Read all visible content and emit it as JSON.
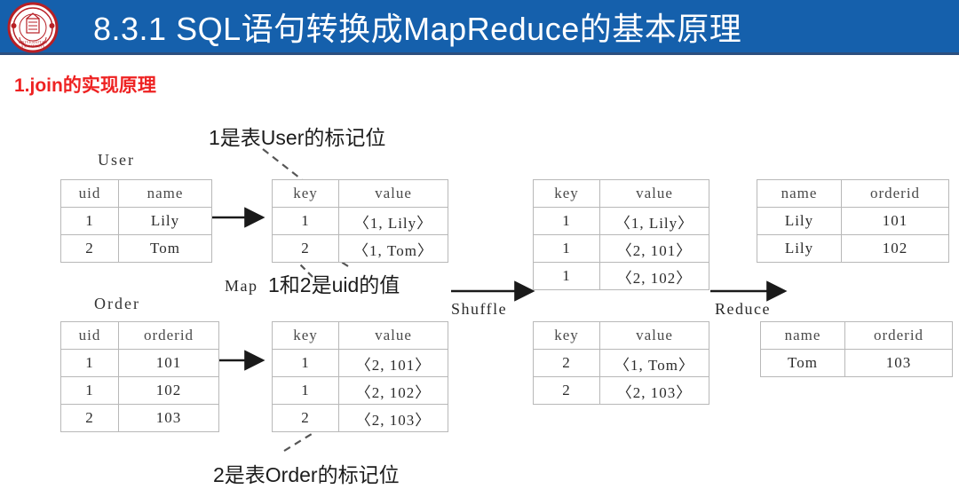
{
  "header": {
    "title": "8.3.1  SQL语句转换成MapReduce的基本原理",
    "logo_name": "university-seal-logo",
    "bar_color": "#1560ac",
    "title_color": "#ffffff"
  },
  "subtitle": {
    "text": "1.join的实现原理",
    "color": "#ee2222"
  },
  "diagram": {
    "captions": {
      "user": "User",
      "order": "Order"
    },
    "step_labels": {
      "map": "Map",
      "shuffle": "Shuffle",
      "reduce": "Reduce"
    },
    "annotations": {
      "top": "1是表User的标记位",
      "middle": "1和2是uid的值",
      "bottom": "2是表Order的标记位"
    },
    "tables": {
      "user": {
        "headers": [
          "uid",
          "name"
        ],
        "rows": [
          [
            "1",
            "Lily"
          ],
          [
            "2",
            "Tom"
          ]
        ]
      },
      "order": {
        "headers": [
          "uid",
          "orderid"
        ],
        "rows": [
          [
            "1",
            "101"
          ],
          [
            "1",
            "102"
          ],
          [
            "2",
            "103"
          ]
        ]
      },
      "map_user": {
        "headers": [
          "key",
          "value"
        ],
        "rows": [
          [
            "1",
            "〈1, Lily〉"
          ],
          [
            "2",
            "〈1, Tom〉"
          ]
        ]
      },
      "map_order": {
        "headers": [
          "key",
          "value"
        ],
        "rows": [
          [
            "1",
            "〈2, 101〉"
          ],
          [
            "1",
            "〈2, 102〉"
          ],
          [
            "2",
            "〈2, 103〉"
          ]
        ]
      },
      "shuffle_key1": {
        "headers": [
          "key",
          "value"
        ],
        "rows": [
          [
            "1",
            "〈1, Lily〉"
          ],
          [
            "1",
            "〈2, 101〉"
          ],
          [
            "1",
            "〈2, 102〉"
          ]
        ]
      },
      "shuffle_key2": {
        "headers": [
          "key",
          "value"
        ],
        "rows": [
          [
            "2",
            "〈1, Tom〉"
          ],
          [
            "2",
            "〈2, 103〉"
          ]
        ]
      },
      "reduce_top": {
        "headers": [
          "name",
          "orderid"
        ],
        "rows": [
          [
            "Lily",
            "101"
          ],
          [
            "Lily",
            "102"
          ]
        ]
      },
      "reduce_bottom": {
        "headers": [
          "name",
          "orderid"
        ],
        "rows": [
          [
            "Tom",
            "103"
          ]
        ]
      }
    }
  }
}
